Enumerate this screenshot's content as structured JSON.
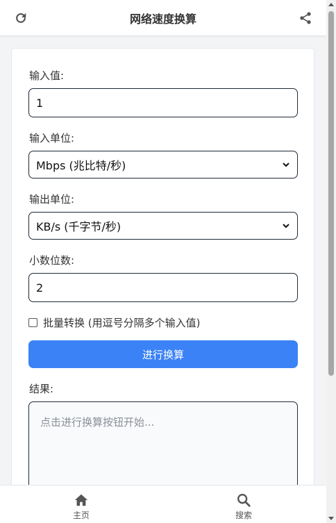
{
  "header": {
    "title": "网络速度换算",
    "refresh_icon": "refresh-icon",
    "share_icon": "share-icon"
  },
  "form": {
    "input_label": "输入值:",
    "input_value": "1",
    "input_unit_label": "输入单位:",
    "input_unit_selected": "Mbps (兆比特/秒)",
    "output_unit_label": "输出单位:",
    "output_unit_selected": "KB/s (千字节/秒)",
    "decimals_label": "小数位数:",
    "decimals_value": "2",
    "batch_label": "批量转换 (用逗号分隔多个输入值)",
    "batch_checked": false,
    "convert_button": "进行换算",
    "result_label": "结果:",
    "result_placeholder": "点击进行换算按钮开始..."
  },
  "nav": {
    "items": [
      {
        "label": "主页",
        "icon": "home-icon"
      },
      {
        "label": "搜索",
        "icon": "search-icon"
      }
    ]
  },
  "colors": {
    "accent": "#3b82f6",
    "text": "#333333",
    "placeholder": "#8a8f98"
  }
}
